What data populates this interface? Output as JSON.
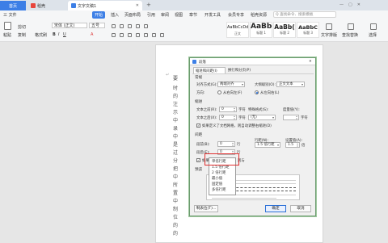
{
  "tabs": {
    "home": "首页",
    "shell": "稻壳",
    "doc": "文字文稿1",
    "new_tab": "+"
  },
  "menu": {
    "file": "三 文件",
    "items": [
      "开始",
      "插入",
      "页面布局",
      "引用",
      "审阅",
      "视图",
      "章节",
      "开发工具",
      "会员专享",
      "稻壳资源"
    ],
    "search": "Q 查找命令、搜索模板"
  },
  "toolbar": {
    "paste": "粘贴",
    "cut": "剪切",
    "copy": "复制",
    "format_painter": "格式刷",
    "font": "宋体 (正文)",
    "size": "五号",
    "styles": [
      {
        "sample": "AaBbCcDd",
        "name": "正文"
      },
      {
        "sample": "AaBb",
        "name": "标题 1"
      },
      {
        "sample": "AaBb(",
        "name": "标题 2"
      },
      {
        "sample": "AaBbC",
        "name": "标题 3"
      }
    ],
    "text_tools": "文字排版",
    "find_replace": "查找替换",
    "select": "选择"
  },
  "document": {
    "side_chars": [
      "要",
      "时",
      "的",
      "注",
      "示",
      "中",
      "录",
      "中",
      "是",
      "过",
      "分",
      "把",
      "中",
      "所",
      "置",
      "中",
      "制",
      "位",
      "的",
      "的"
    ]
  },
  "dialog": {
    "title": "段落",
    "tabs": [
      "缩进和间距(I)",
      "换行和分页(P)"
    ],
    "general": {
      "section": "常规",
      "align_label": "对齐方式(G):",
      "align_value": "两端对齐",
      "outline_label": "大纲级别(O):",
      "outline_value": "正文文本",
      "direction_label": "方向:",
      "rtl": "从右向左(F)",
      "ltr": "从左向右(L)"
    },
    "indent": {
      "section": "缩进",
      "before_label": "文本之前(R):",
      "before_value": "0",
      "before_unit": "字符",
      "special_label": "特殊格式(S):",
      "special_value": "(无)",
      "measure_label": "度量值(Y):",
      "measure_unit": "字符",
      "after_label": "文本之后(X):",
      "after_value": "0",
      "after_unit": "字符",
      "grid_check": "如果定义了文档网格，则自动调整右缩进(D)"
    },
    "spacing": {
      "section": "间距",
      "before_label": "段前(B):",
      "before_value": "0",
      "before_unit": "行",
      "line_label": "行距(N):",
      "line_value": "1.5 倍行距",
      "setting_label": "设置值(A):",
      "setting_value": "1.5",
      "setting_unit": "倍",
      "after_label": "段后(E):",
      "after_value": "0",
      "after_unit": "行",
      "grid_check": "如果定义了文档网格，则与"
    },
    "preview": {
      "section": "预览"
    },
    "buttons": {
      "tabs": "制表位(T)...",
      "ok": "确定",
      "cancel": "取消"
    }
  },
  "line_spacing_options": [
    "单倍行距",
    "1.5 倍行距",
    "2 倍行距",
    "最小值",
    "固定值",
    "多倍行距"
  ],
  "colors": {
    "accent": "#3d7fe6",
    "highlight": "#e03030",
    "ok_button": "#2a6fd6"
  }
}
